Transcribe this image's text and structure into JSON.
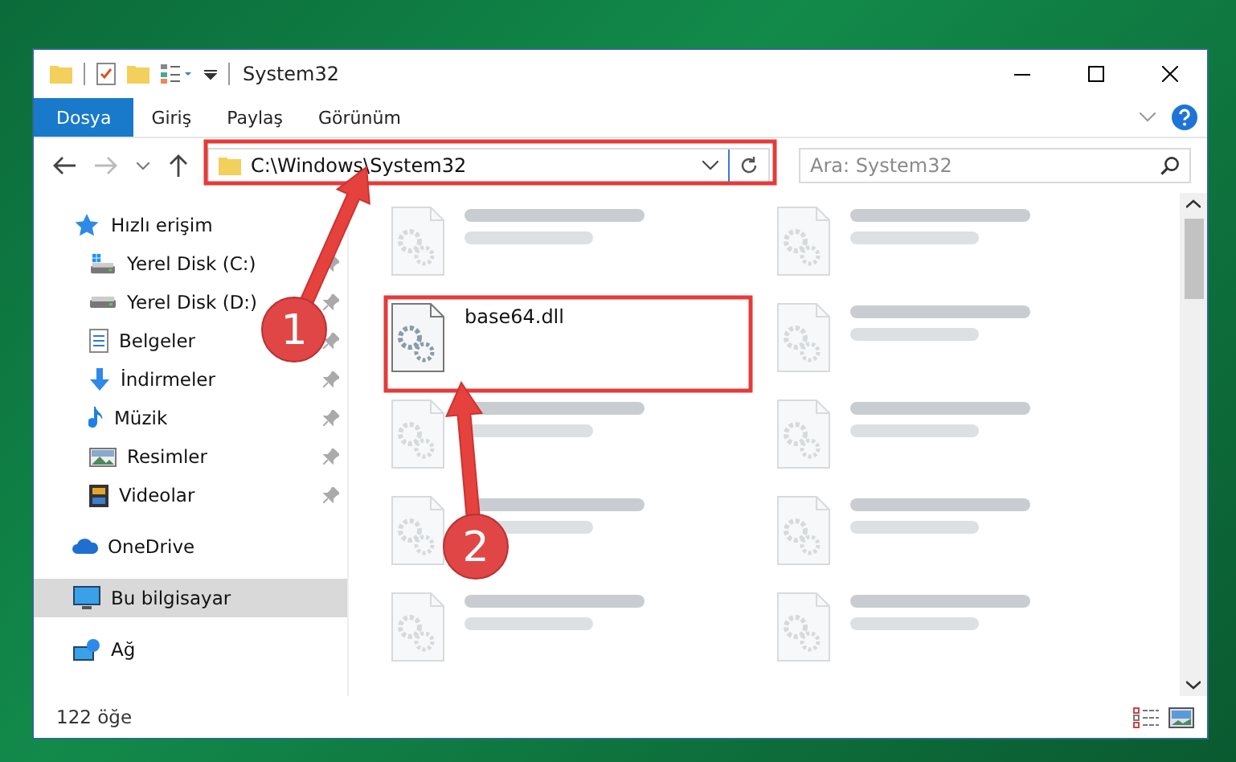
{
  "window": {
    "title": "System32"
  },
  "ribbon_tabs": [
    {
      "label": "Dosya",
      "selected": true
    },
    {
      "label": "Giriş",
      "selected": false
    },
    {
      "label": "Paylaş",
      "selected": false
    },
    {
      "label": "Görünüm",
      "selected": false
    }
  ],
  "address": {
    "path": "C:\\Windows\\System32"
  },
  "search": {
    "placeholder": "Ara: System32"
  },
  "sidebar": {
    "items": [
      {
        "label": "Hızlı erişim",
        "kind": "star",
        "pinned": false,
        "selected": false,
        "children": [
          {
            "label": "Yerel Disk (C:)",
            "kind": "disk-c",
            "pinned": true,
            "selected": false
          },
          {
            "label": "Yerel Disk (D:)",
            "kind": "disk",
            "pinned": true,
            "selected": false
          },
          {
            "label": "Belgeler",
            "kind": "doc",
            "pinned": true,
            "selected": false
          },
          {
            "label": "İndirmeler",
            "kind": "download",
            "pinned": true,
            "selected": false
          },
          {
            "label": "Müzik",
            "kind": "music",
            "pinned": true,
            "selected": false
          },
          {
            "label": "Resimler",
            "kind": "image",
            "pinned": true,
            "selected": false
          },
          {
            "label": "Videolar",
            "kind": "video",
            "pinned": true,
            "selected": false
          }
        ]
      },
      {
        "label": "OneDrive",
        "kind": "cloud",
        "pinned": false,
        "selected": false
      },
      {
        "label": "Bu bilgisayar",
        "kind": "pc",
        "pinned": false,
        "selected": true
      },
      {
        "label": "Ağ",
        "kind": "network",
        "pinned": false,
        "selected": false
      }
    ]
  },
  "files": [
    {
      "kind": "blurred"
    },
    {
      "kind": "blurred"
    },
    {
      "kind": "file",
      "name": "base64.dll"
    },
    {
      "kind": "blurred"
    },
    {
      "kind": "blurred"
    },
    {
      "kind": "blurred"
    },
    {
      "kind": "blurred"
    },
    {
      "kind": "blurred"
    },
    {
      "kind": "blurred"
    },
    {
      "kind": "blurred"
    }
  ],
  "annotations": [
    {
      "number": "1"
    },
    {
      "number": "2"
    }
  ],
  "status_bar": {
    "count": "122 öğe"
  }
}
